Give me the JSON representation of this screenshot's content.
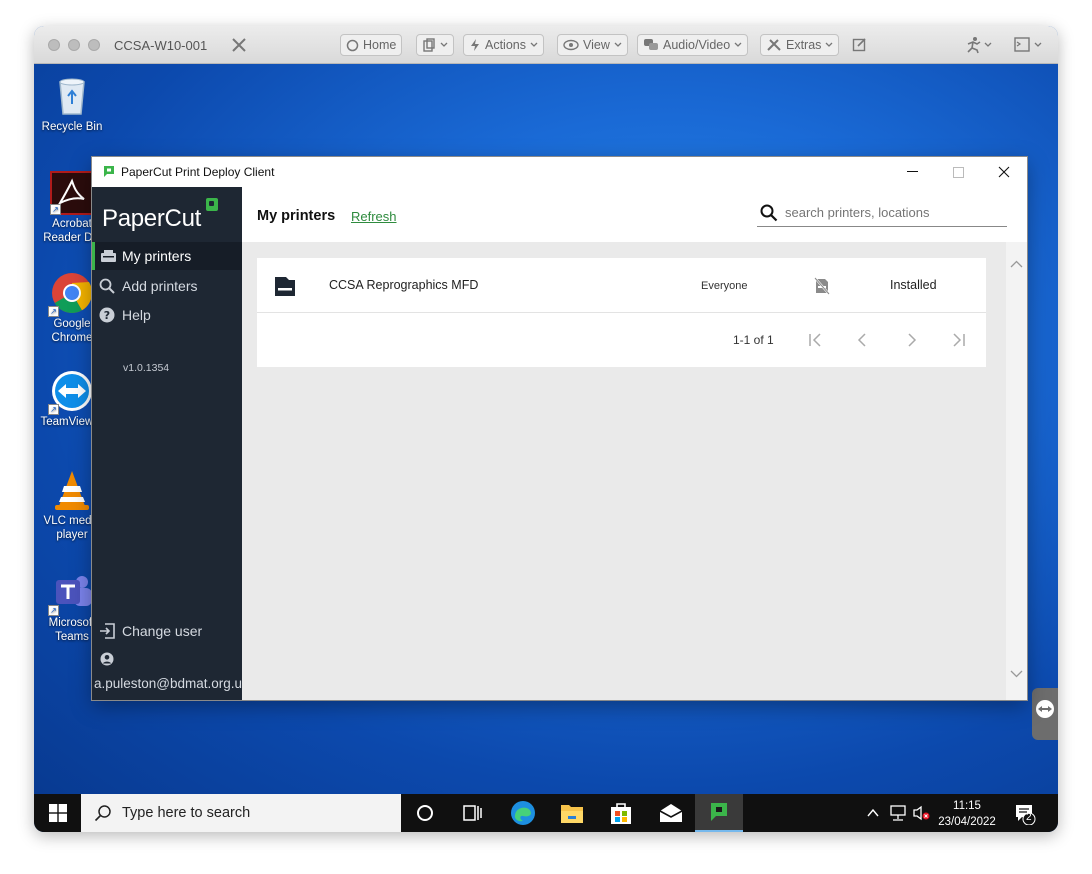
{
  "remote_toolbar": {
    "title": "CCSA-W10-001",
    "home": "Home",
    "actions": "Actions",
    "view": "View",
    "audio_video": "Audio/Video",
    "extras": "Extras"
  },
  "desktop_icons": [
    {
      "label": "Recycle Bin",
      "icon": "recycle-bin-icon"
    },
    {
      "label": "Acrobat Reader DC",
      "icon": "acrobat-icon"
    },
    {
      "label": "Google Chrome",
      "icon": "chrome-icon"
    },
    {
      "label": "TeamViewer",
      "icon": "teamviewer-icon"
    },
    {
      "label": "VLC media player",
      "icon": "vlc-icon"
    },
    {
      "label": "Microsoft Teams",
      "icon": "teams-icon"
    }
  ],
  "app": {
    "window_title": "PaperCut Print Deploy Client",
    "brand": "PaperCut",
    "nav": {
      "my_printers": "My printers",
      "add_printers": "Add printers",
      "help": "Help"
    },
    "version": "v1.0.1354",
    "change_user": "Change user",
    "user_email": "a.puleston@bdmat.org.uk",
    "header_title": "My printers",
    "refresh": "Refresh",
    "search_placeholder": "search printers, locations",
    "printers": [
      {
        "name": "CCSA Reprographics MFD",
        "group": "Everyone",
        "status": "Installed"
      }
    ],
    "pagination": "1-1 of 1"
  },
  "taskbar": {
    "search_placeholder": "Type here to search",
    "time": "11:15",
    "date": "23/04/2022",
    "notifications": "2"
  },
  "colors": {
    "accent_green": "#3bb54a",
    "sidebar_bg": "#1e2733",
    "desktop_blue": "#1a6ad6"
  }
}
